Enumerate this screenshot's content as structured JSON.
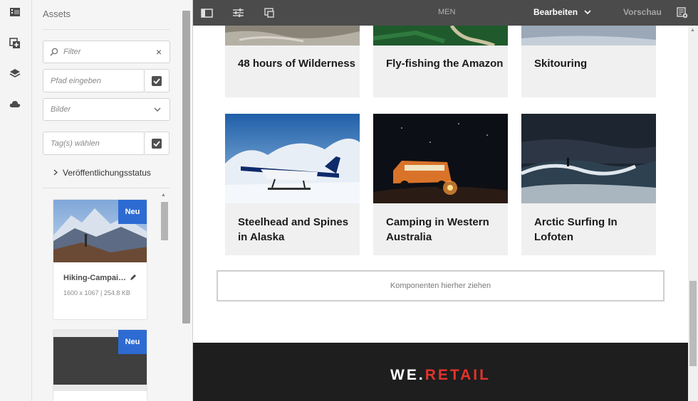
{
  "rail": {
    "icons": [
      "filmstrip-icon",
      "add-component-icon",
      "layers-icon",
      "cloud-icon"
    ]
  },
  "assets_panel": {
    "title": "Assets",
    "filter": {
      "placeholder": "Filter"
    },
    "path": {
      "placeholder": "Pfad eingeben"
    },
    "type_select": {
      "value": "Bilder"
    },
    "tags": {
      "placeholder": "Tag(s) wählen"
    },
    "publish_status_label": "Veröffentlichungsstatus",
    "assets": [
      {
        "name": "Hiking-Campai…",
        "meta": "1600 x 1067 | 254.8 KB",
        "badge": "Neu"
      },
      {
        "name": "",
        "meta": "",
        "badge": "Neu"
      }
    ]
  },
  "toolbar": {
    "men_label": "MEN",
    "edit_label": "Bearbeiten",
    "preview_label": "Vorschau"
  },
  "content": {
    "tiles_row1": [
      {
        "title": "48 hours of Wilderness"
      },
      {
        "title": "Fly-fishing the Amazon"
      },
      {
        "title": "Skitouring"
      }
    ],
    "tiles_row2": [
      {
        "title": "Steelhead and Spines in Alaska"
      },
      {
        "title": "Camping in Western Australia"
      },
      {
        "title": "Arctic Surfing In Lofoten"
      }
    ],
    "dropzone_label": "Komponenten hierher ziehen",
    "footer": {
      "brand_we": "WE.",
      "brand_retail": "RETAIL"
    }
  },
  "colors": {
    "toolbar_bg": "#4b4b4b",
    "badge_blue": "#2d6bd3",
    "brand_red": "#e2332c",
    "footer_bg": "#1e1e1e"
  }
}
